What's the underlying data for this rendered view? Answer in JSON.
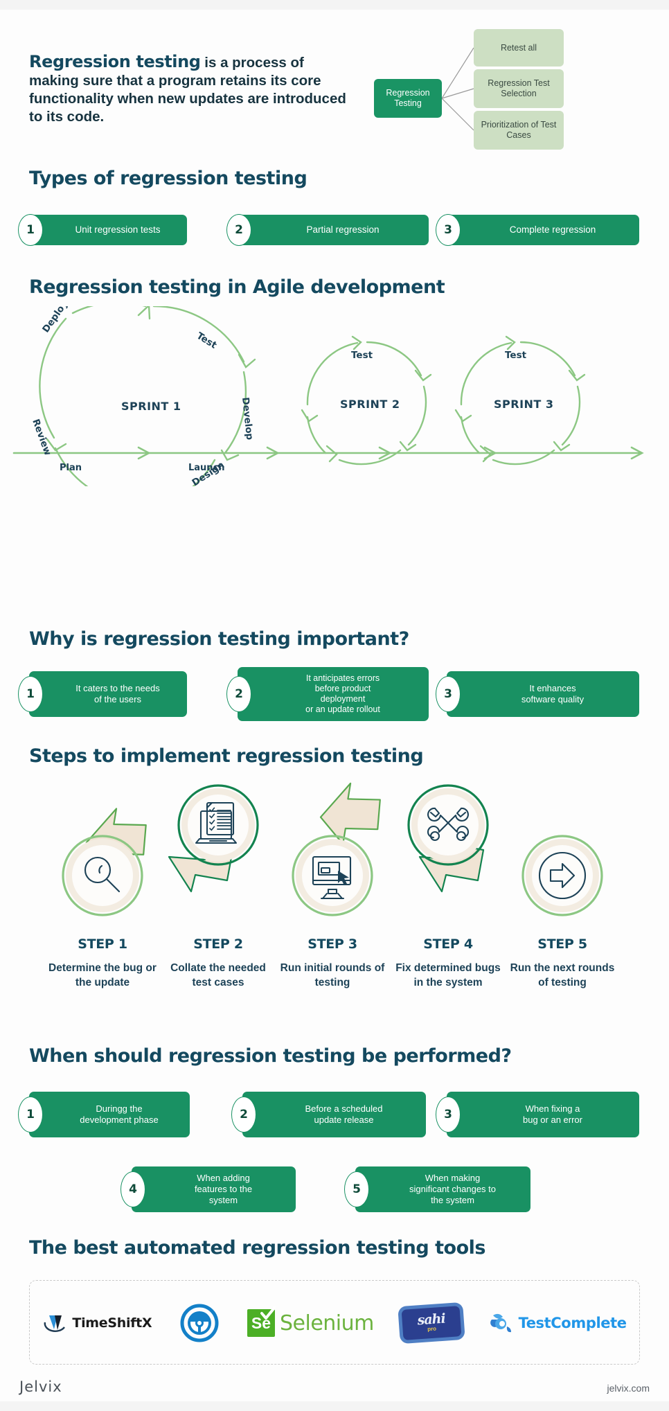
{
  "intro": {
    "lead": "Regression testing",
    "rest": " is a process of making sure that a program retains its core functionality when new updates are introduced to its code."
  },
  "tree": {
    "root": "Regression Testing",
    "leaves": [
      "Retest all",
      "Regression Test Selection",
      "Prioritization of Test Cases"
    ]
  },
  "sections": {
    "types": "Types of regression testing",
    "agile": "Regression testing in Agile development",
    "why": "Why is regression testing important?",
    "steps": "Steps to implement regression testing",
    "when": "When should regression testing be performed?",
    "tools": "The best automated regression testing tools"
  },
  "types": [
    {
      "num": "1",
      "label": "Unit regression tests"
    },
    {
      "num": "2",
      "label": "Partial regression"
    },
    {
      "num": "3",
      "label": "Complete regression"
    }
  ],
  "agile": {
    "sprints": [
      {
        "name": "SPRINT 1",
        "phases": [
          "Test",
          "Develop",
          "Design",
          "Review",
          "Deploy"
        ]
      },
      {
        "name": "SPRINT 2",
        "phases": [
          "Test"
        ]
      },
      {
        "name": "SPRINT 3",
        "phases": [
          "Test"
        ]
      }
    ],
    "baseline": [
      "Plan",
      "Launch"
    ],
    "labels": {
      "test": "Test",
      "develop": "Develop",
      "design": "Design",
      "review": "Review",
      "deploy": "Deploy",
      "plan": "Plan",
      "launch": "Launch"
    }
  },
  "why": [
    {
      "num": "1",
      "label": "It caters to the needs\nof the users"
    },
    {
      "num": "2",
      "label": "It anticipates errors\nbefore product\ndeployment\nor an update rollout"
    },
    {
      "num": "3",
      "label": "It enhances\nsoftware quality"
    }
  ],
  "steps": [
    {
      "title": "STEP 1",
      "desc": "Determine the bug or the update",
      "icon": "magnifier-icon"
    },
    {
      "title": "STEP 2",
      "desc": "Collate the needed test cases",
      "icon": "checklist-laptop-icon"
    },
    {
      "title": "STEP 3",
      "desc": "Run initial rounds of testing",
      "icon": "monitor-cursor-icon"
    },
    {
      "title": "STEP 4",
      "desc": "Fix determined bugs in the system",
      "icon": "crossed-wrenches-icon"
    },
    {
      "title": "STEP 5",
      "desc": "Run the next rounds of testing",
      "icon": "arrow-circle-icon"
    }
  ],
  "when": [
    {
      "num": "1",
      "label": "Duringg the\ndevelopment phase"
    },
    {
      "num": "2",
      "label": "Before a scheduled\nupdate release"
    },
    {
      "num": "3",
      "label": "When fixing a\nbug or an error"
    },
    {
      "num": "4",
      "label": "When adding\nfeatures to the\nsystem"
    },
    {
      "num": "5",
      "label": "When making\nsignificant changes to\nthe system"
    }
  ],
  "tools": [
    {
      "name": "TimeShiftX",
      "id": "timeshiftx-logo"
    },
    {
      "name": "",
      "id": "steering-wheel-logo"
    },
    {
      "name": "Selenium",
      "id": "selenium-logo",
      "mark": "Se"
    },
    {
      "name": "sahi",
      "id": "sahi-pro-logo",
      "sub": "pro"
    },
    {
      "name": "TestComplete",
      "id": "testcomplete-logo"
    }
  ],
  "footer": {
    "brand": "Jelvix",
    "site": "jelvix.com"
  },
  "colors": {
    "green": "#199163",
    "light_green": "#cddfc3",
    "arrow_green": "#8cc783",
    "navy": "#14495f",
    "cream": "#f3ece1"
  }
}
